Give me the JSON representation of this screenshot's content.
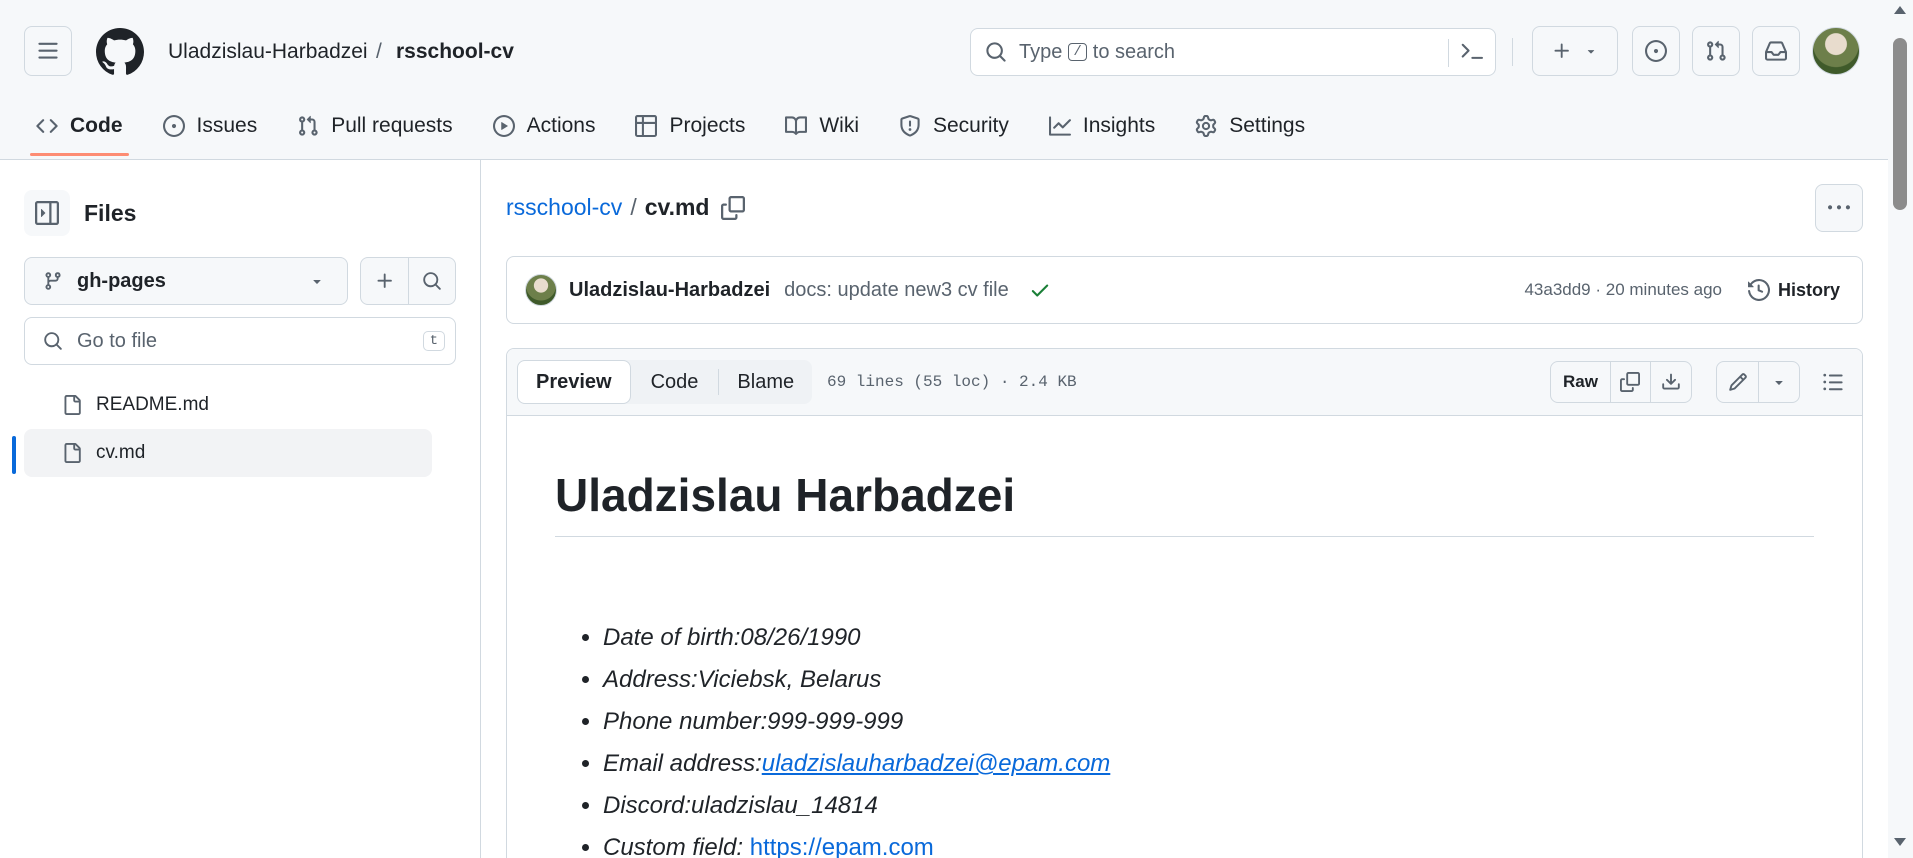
{
  "header": {
    "owner": "Uladzislau-Harbadzei",
    "separator": "/",
    "repo": "rsschool-cv",
    "search_placeholder_prefix": "Type",
    "search_key": "/",
    "search_placeholder_suffix": "to search"
  },
  "nav": {
    "tabs": [
      {
        "label": "Code",
        "icon": "code-icon",
        "active": true
      },
      {
        "label": "Issues",
        "icon": "issue-opened-icon"
      },
      {
        "label": "Pull requests",
        "icon": "git-pull-request-icon"
      },
      {
        "label": "Actions",
        "icon": "play-icon"
      },
      {
        "label": "Projects",
        "icon": "table-icon"
      },
      {
        "label": "Wiki",
        "icon": "book-icon"
      },
      {
        "label": "Security",
        "icon": "shield-icon"
      },
      {
        "label": "Insights",
        "icon": "graph-icon"
      },
      {
        "label": "Settings",
        "icon": "gear-icon"
      }
    ],
    "active_underline_color": "#fd8c73"
  },
  "sidebar": {
    "title": "Files",
    "branch": "gh-pages",
    "go_to_file_placeholder": "Go to file",
    "go_to_file_key": "t",
    "files": [
      {
        "name": "README.md",
        "selected": false
      },
      {
        "name": "cv.md",
        "selected": true
      }
    ]
  },
  "breadcrumb": {
    "repo": "rsschool-cv",
    "separator": "/",
    "file": "cv.md"
  },
  "commit": {
    "author": "Uladzislau-Harbadzei",
    "message": "docs: update new3 cv file",
    "sha_time": "43a3dd9 · 20 minutes ago",
    "history_label": "History",
    "status": "success"
  },
  "file_toolbar": {
    "tabs": [
      "Preview",
      "Code",
      "Blame"
    ],
    "active_tab": "Preview",
    "meta": "69 lines (55 loc) · 2.4 KB",
    "raw_label": "Raw"
  },
  "content": {
    "title": "Uladzislau Harbadzei",
    "items": {
      "dob": "Date of birth:08/26/1990",
      "address": "Address:Viciebsk, Belarus",
      "phone": "Phone number:999-999-999",
      "email_label": "Email address:",
      "email_link": "uladzislauharbadzei@epam.com",
      "discord": "Discord:uladzislau_14814",
      "custom_label": "Custom field: ",
      "custom_link": "https://epam.com"
    }
  },
  "colors": {
    "accent_link": "#0969da",
    "success": "#1a7f37",
    "selected_indicator": "#0969da"
  }
}
